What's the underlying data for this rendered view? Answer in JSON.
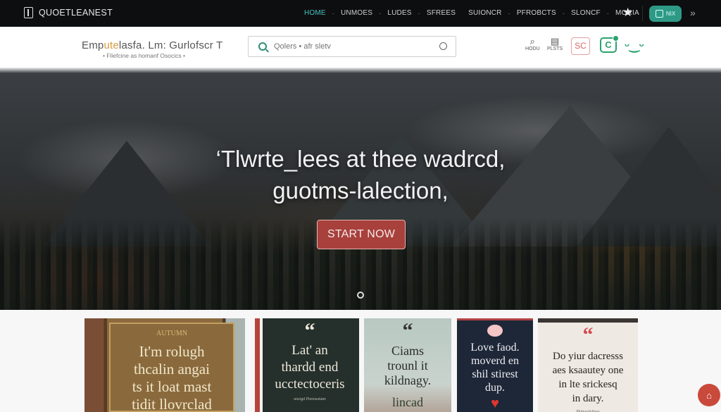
{
  "topbar": {
    "brand": "QUOETLEANEST",
    "nav": [
      {
        "label": "HOME",
        "active": true
      },
      {
        "label": "UNMOES"
      },
      {
        "label": "LUDES"
      },
      {
        "label": "SFREES"
      },
      {
        "label": "SUIONCR"
      },
      {
        "label": "PFROBCTS"
      },
      {
        "label": "SLONCF"
      },
      {
        "label": "MORIA"
      }
    ],
    "cta_label": "NIX",
    "accent_color": "#45c4c0"
  },
  "header": {
    "title_pre": "Emp",
    "title_hl": "ute",
    "title_post": "lasfa. Lm: Gurlofscr T",
    "subtitle": "• Fliefcine as homanf Osocics •",
    "search": {
      "placeholder": "Qolers • afr sletv",
      "value": ""
    },
    "icons": [
      {
        "name": "search",
        "label": "HODU"
      },
      {
        "name": "lists",
        "label": "PLSTS"
      }
    ],
    "sc_label": "SC",
    "c_label": "C"
  },
  "hero": {
    "title_line1": "‘Tlwrte_lees at thee wadrcd,",
    "title_line2": "guotms-lalection,",
    "cta": "START NOW"
  },
  "cards": [
    {
      "label": "AUTUMN",
      "quote": [
        "It'm rolugh",
        "thcalin angai",
        "ts it loat mast",
        "tidit llovrclad"
      ]
    },
    {
      "quote": [
        "Lat' an",
        "thardd end",
        "ucctectoceris"
      ],
      "attribution": "unsigd Pteensatane"
    },
    {
      "quote": [
        "Ciams",
        "trounl it",
        "kildnagy."
      ],
      "footer": "lincad"
    },
    {
      "quote": [
        "Love faod.",
        "moverd en",
        "shil stirest",
        "dup."
      ]
    },
    {
      "quote": [
        "Do yiur dacresss",
        "aes ksaautey one",
        "in lte srickesq",
        "in dary."
      ],
      "attribution": "Pkbnaslklinas"
    }
  ]
}
